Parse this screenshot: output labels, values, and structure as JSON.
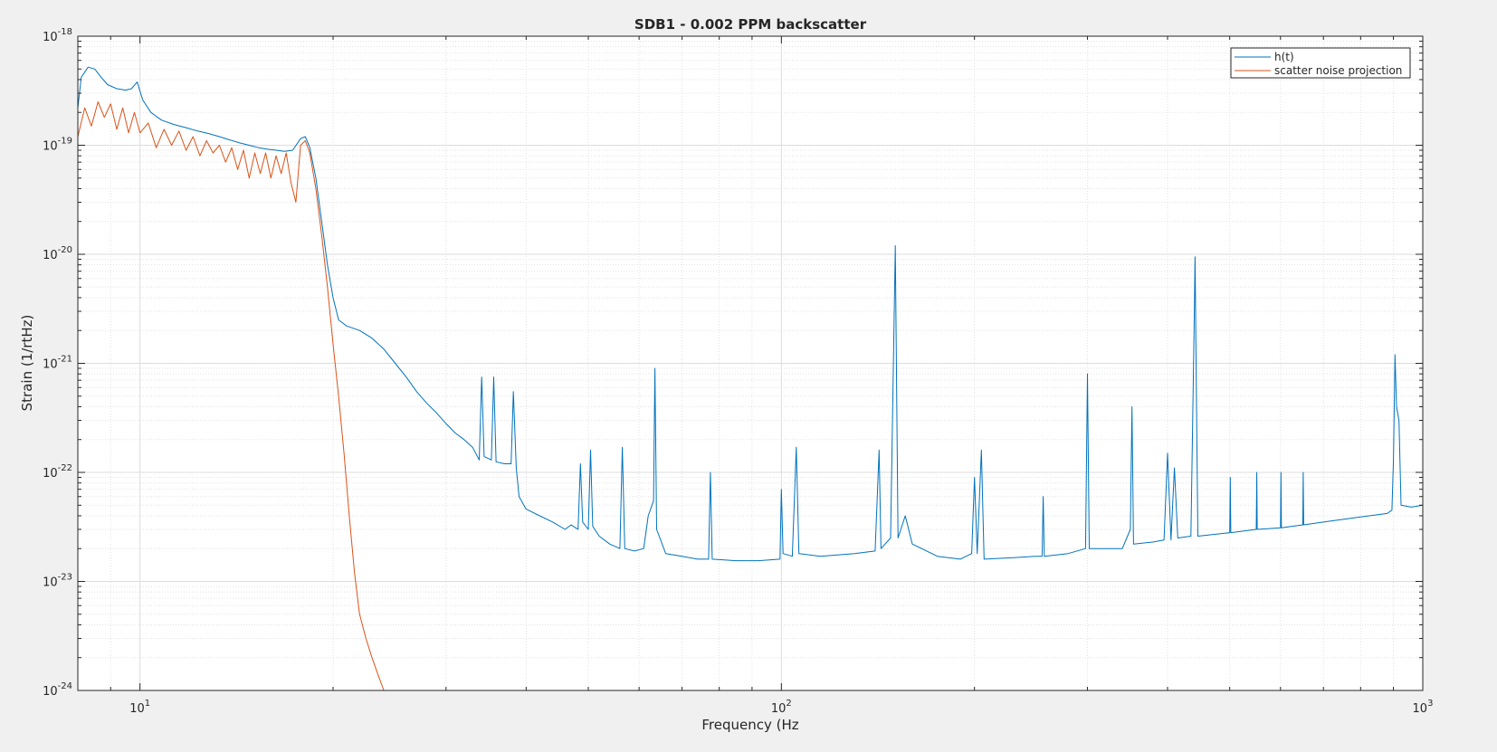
{
  "chart_data": {
    "type": "line",
    "title": "SDB1 - 0.002 PPM backscatter",
    "xlabel": "Frequency (Hz",
    "ylabel": "Strain (1/rtHz)",
    "xscale": "log",
    "yscale": "log",
    "xlim": [
      8,
      1000
    ],
    "ylim": [
      1e-24,
      1e-18
    ],
    "grid": true,
    "minor_grid": true,
    "legend_position": "top-right",
    "x_ticks": [
      {
        "value": 10,
        "base": "10",
        "exp": "1"
      },
      {
        "value": 100,
        "base": "10",
        "exp": "2"
      },
      {
        "value": 1000,
        "base": "10",
        "exp": "3"
      }
    ],
    "y_ticks": [
      {
        "value": 1e-24,
        "base": "10",
        "exp": "-24"
      },
      {
        "value": 1e-23,
        "base": "10",
        "exp": "-23"
      },
      {
        "value": 1e-22,
        "base": "10",
        "exp": "-22"
      },
      {
        "value": 1e-21,
        "base": "10",
        "exp": "-21"
      },
      {
        "value": 1e-20,
        "base": "10",
        "exp": "-20"
      },
      {
        "value": 1e-19,
        "base": "10",
        "exp": "-19"
      },
      {
        "value": 1e-18,
        "base": "10",
        "exp": "-18"
      }
    ],
    "series": [
      {
        "name": "h(t)",
        "color": "#0072bd",
        "points": [
          [
            8.0,
            2.2e-19
          ],
          [
            8.1,
            4.2e-19
          ],
          [
            8.3,
            5.2e-19
          ],
          [
            8.5,
            5e-19
          ],
          [
            8.7,
            4.2e-19
          ],
          [
            8.9,
            3.6e-19
          ],
          [
            9.2,
            3.3e-19
          ],
          [
            9.5,
            3.2e-19
          ],
          [
            9.7,
            3.3e-19
          ],
          [
            9.9,
            3.8e-19
          ],
          [
            10.1,
            2.6e-19
          ],
          [
            10.4,
            2e-19
          ],
          [
            10.8,
            1.7e-19
          ],
          [
            11.3,
            1.55e-19
          ],
          [
            11.8,
            1.45e-19
          ],
          [
            12.3,
            1.35e-19
          ],
          [
            12.8,
            1.28e-19
          ],
          [
            13.3,
            1.2e-19
          ],
          [
            13.8,
            1.12e-19
          ],
          [
            14.3,
            1.05e-19
          ],
          [
            14.8,
            1e-19
          ],
          [
            15.3,
            9.5e-20
          ],
          [
            15.8,
            9.2e-20
          ],
          [
            16.3,
            9e-20
          ],
          [
            16.8,
            8.8e-20
          ],
          [
            17.3,
            9e-20
          ],
          [
            17.8,
            1.15e-19
          ],
          [
            18.1,
            1.2e-19
          ],
          [
            18.4,
            9.5e-20
          ],
          [
            18.8,
            5e-20
          ],
          [
            19.2,
            2e-20
          ],
          [
            19.6,
            8e-21
          ],
          [
            20.0,
            4e-21
          ],
          [
            20.4,
            2.5e-21
          ],
          [
            21.0,
            2.2e-21
          ],
          [
            22.0,
            2e-21
          ],
          [
            23.0,
            1.7e-21
          ],
          [
            24.0,
            1.35e-21
          ],
          [
            25.0,
            1e-21
          ],
          [
            26.0,
            7.5e-22
          ],
          [
            27.0,
            5.5e-22
          ],
          [
            28.0,
            4.3e-22
          ],
          [
            29.0,
            3.5e-22
          ],
          [
            30.0,
            2.8e-22
          ],
          [
            31.0,
            2.3e-22
          ],
          [
            32.0,
            2e-22
          ],
          [
            33.0,
            1.7e-22
          ],
          [
            33.8,
            1.3e-22
          ],
          [
            34.1,
            7.5e-22
          ],
          [
            34.4,
            1.4e-22
          ],
          [
            35.3,
            1.3e-22
          ],
          [
            35.6,
            7.5e-22
          ],
          [
            35.9,
            1.25e-22
          ],
          [
            37.0,
            1.2e-22
          ],
          [
            37.9,
            1.2e-22
          ],
          [
            38.2,
            5.5e-22
          ],
          [
            38.6,
            1.1e-22
          ],
          [
            39.0,
            6e-23
          ],
          [
            40.0,
            4.6e-23
          ],
          [
            42.0,
            4e-23
          ],
          [
            44.0,
            3.5e-23
          ],
          [
            46.0,
            3e-23
          ],
          [
            47.0,
            3.3e-23
          ],
          [
            48.2,
            3e-23
          ],
          [
            48.6,
            1.2e-22
          ],
          [
            49.0,
            3.5e-23
          ],
          [
            50.0,
            3e-23
          ],
          [
            50.4,
            1.6e-22
          ],
          [
            50.8,
            3.2e-23
          ],
          [
            52.0,
            2.6e-23
          ],
          [
            54.0,
            2.2e-23
          ],
          [
            56.0,
            2e-23
          ],
          [
            56.5,
            1.7e-22
          ],
          [
            57.0,
            2e-23
          ],
          [
            59.0,
            1.9e-23
          ],
          [
            61.0,
            2e-23
          ],
          [
            62.0,
            4e-23
          ],
          [
            63.2,
            5.5e-23
          ],
          [
            63.5,
            9e-22
          ],
          [
            63.9,
            3e-23
          ],
          [
            66.0,
            1.8e-23
          ],
          [
            70.0,
            1.7e-23
          ],
          [
            74.0,
            1.6e-23
          ],
          [
            77.0,
            1.6e-23
          ],
          [
            77.5,
            1e-22
          ],
          [
            78.0,
            1.6e-23
          ],
          [
            85.0,
            1.55e-23
          ],
          [
            92.0,
            1.55e-23
          ],
          [
            99.5,
            1.6e-23
          ],
          [
            100.0,
            7e-23
          ],
          [
            100.6,
            1.8e-23
          ],
          [
            104.0,
            1.7e-23
          ],
          [
            105.5,
            1.7e-22
          ],
          [
            106.5,
            1.8e-23
          ],
          [
            115.0,
            1.7e-23
          ],
          [
            130.0,
            1.8e-23
          ],
          [
            140.0,
            1.9e-23
          ],
          [
            142.0,
            1.6e-22
          ],
          [
            143.0,
            2e-23
          ],
          [
            148.0,
            2.5e-23
          ],
          [
            150.5,
            1.2e-20
          ],
          [
            152.0,
            2.5e-23
          ],
          [
            156.0,
            4e-23
          ],
          [
            160.0,
            2.2e-23
          ],
          [
            175.0,
            1.7e-23
          ],
          [
            190.0,
            1.6e-23
          ],
          [
            198.0,
            1.8e-23
          ],
          [
            200.0,
            9e-23
          ],
          [
            202.0,
            1.8e-23
          ],
          [
            205.0,
            1.6e-22
          ],
          [
            207.0,
            1.6e-23
          ],
          [
            230.0,
            1.65e-23
          ],
          [
            250.0,
            1.7e-23
          ],
          [
            255.0,
            1.7e-23
          ],
          [
            256.0,
            6e-23
          ],
          [
            257.0,
            1.7e-23
          ],
          [
            280.0,
            1.8e-23
          ],
          [
            298.0,
            2e-23
          ],
          [
            300.0,
            8e-22
          ],
          [
            302.0,
            2e-23
          ],
          [
            340.0,
            2e-23
          ],
          [
            350.0,
            3e-23
          ],
          [
            352.0,
            4e-22
          ],
          [
            354.0,
            2.2e-23
          ],
          [
            380.0,
            2.3e-23
          ],
          [
            395.0,
            2.4e-23
          ],
          [
            400.0,
            1.5e-22
          ],
          [
            405.0,
            2.4e-23
          ],
          [
            410.0,
            1.1e-22
          ],
          [
            415.0,
            2.5e-23
          ],
          [
            435.0,
            2.6e-23
          ],
          [
            440.0,
            2e-21
          ],
          [
            441.5,
            9.5e-21
          ],
          [
            443.0,
            1.3e-21
          ],
          [
            446.0,
            2.6e-23
          ],
          [
            500.0,
            2.8e-23
          ],
          [
            501.0,
            9e-23
          ],
          [
            502.0,
            2.8e-23
          ],
          [
            550.0,
            3e-23
          ],
          [
            551.0,
            1e-22
          ],
          [
            552.0,
            3e-23
          ],
          [
            600.0,
            3.1e-23
          ],
          [
            601.0,
            1e-22
          ],
          [
            602.0,
            3.1e-23
          ],
          [
            650.0,
            3.3e-23
          ],
          [
            651.0,
            1e-22
          ],
          [
            652.0,
            3.3e-23
          ],
          [
            700.0,
            3.5e-23
          ],
          [
            800.0,
            3.9e-23
          ],
          [
            880.0,
            4.2e-23
          ],
          [
            895.0,
            4.5e-23
          ],
          [
            900.0,
            1.3e-22
          ],
          [
            905.0,
            1.2e-21
          ],
          [
            910.0,
            4e-22
          ],
          [
            918.0,
            3e-22
          ],
          [
            925.0,
            5e-23
          ],
          [
            960.0,
            4.8e-23
          ],
          [
            1000.0,
            5e-23
          ]
        ]
      },
      {
        "name": "scatter noise projection",
        "color": "#d95319",
        "points": [
          [
            8.0,
            1.2e-19
          ],
          [
            8.2,
            2.2e-19
          ],
          [
            8.4,
            1.5e-19
          ],
          [
            8.6,
            2.5e-19
          ],
          [
            8.8,
            1.8e-19
          ],
          [
            9.0,
            2.4e-19
          ],
          [
            9.2,
            1.4e-19
          ],
          [
            9.4,
            2.2e-19
          ],
          [
            9.6,
            1.3e-19
          ],
          [
            9.8,
            2e-19
          ],
          [
            10.0,
            1.3e-19
          ],
          [
            10.3,
            1.6e-19
          ],
          [
            10.6,
            9.5e-20
          ],
          [
            10.9,
            1.4e-19
          ],
          [
            11.2,
            1e-19
          ],
          [
            11.5,
            1.35e-19
          ],
          [
            11.8,
            9e-20
          ],
          [
            12.1,
            1.2e-19
          ],
          [
            12.4,
            8e-20
          ],
          [
            12.7,
            1.1e-19
          ],
          [
            13.0,
            8.5e-20
          ],
          [
            13.3,
            1e-19
          ],
          [
            13.6,
            7e-20
          ],
          [
            13.9,
            9.5e-20
          ],
          [
            14.2,
            6e-20
          ],
          [
            14.5,
            9e-20
          ],
          [
            14.8,
            5e-20
          ],
          [
            15.1,
            8.5e-20
          ],
          [
            15.4,
            5.5e-20
          ],
          [
            15.7,
            8.5e-20
          ],
          [
            16.0,
            5e-20
          ],
          [
            16.3,
            8e-20
          ],
          [
            16.6,
            5.5e-20
          ],
          [
            16.9,
            8.5e-20
          ],
          [
            17.2,
            4.5e-20
          ],
          [
            17.5,
            3e-20
          ],
          [
            17.8,
            1e-19
          ],
          [
            18.1,
            1.1e-19
          ],
          [
            18.4,
            8.5e-20
          ],
          [
            18.8,
            4e-20
          ],
          [
            19.2,
            1.5e-20
          ],
          [
            19.6,
            5e-21
          ],
          [
            20.0,
            1.5e-21
          ],
          [
            20.4,
            5e-22
          ],
          [
            20.8,
            1.5e-22
          ],
          [
            21.2,
            4e-23
          ],
          [
            21.6,
            1.2e-23
          ],
          [
            22.0,
            5e-24
          ],
          [
            22.5,
            3e-24
          ],
          [
            23.0,
            2e-24
          ],
          [
            23.5,
            1.4e-24
          ],
          [
            24.0,
            1e-24
          ]
        ]
      }
    ]
  }
}
